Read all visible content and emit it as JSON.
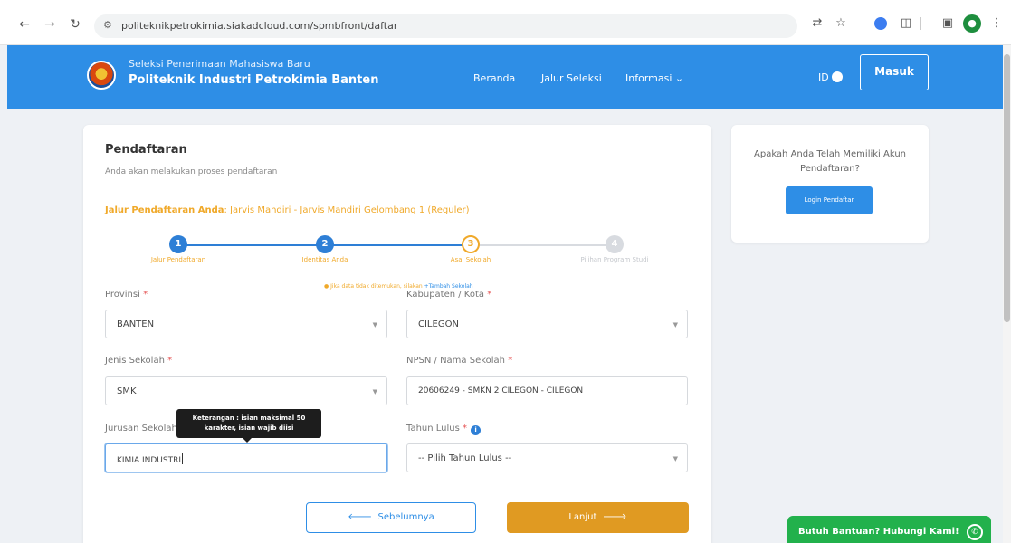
{
  "browser": {
    "url": "politeknikpetrokimia.siakadcloud.com/spmbfront/daftar"
  },
  "header": {
    "subtitle": "Seleksi Penerimaan Mahasiswa Baru",
    "title": "Politeknik Industri Petrokimia Banten",
    "menu": [
      "Beranda",
      "Jalur Seleksi",
      "Informasi ⌄"
    ],
    "lang": "ID",
    "login_label": "Masuk"
  },
  "form": {
    "title": "Pendaftaran",
    "subtitle": "Anda akan melakukan proses pendaftaran",
    "jalur_label": "Jalur Pendaftaran Anda",
    "jalur_value": ": Jarvis Mandiri - Jarvis Mandiri Gelombang 1 (Reguler)",
    "steps": [
      {
        "num": "1",
        "label": "Jalur Pendaftaran",
        "state": "done"
      },
      {
        "num": "2",
        "label": "Identitas Anda",
        "state": "done"
      },
      {
        "num": "3",
        "label": "Asal Sekolah",
        "state": "active"
      },
      {
        "num": "4",
        "label": "Pilihan Program Studi",
        "state": "pending"
      }
    ],
    "provinsi_label": "Provinsi",
    "provinsi_value": "BANTEN",
    "kabupaten_label": "Kabupaten / Kota",
    "kabupaten_value": "CILEGON",
    "jenis_label": "Jenis Sekolah",
    "jenis_value": "SMK",
    "npsn_label": "NPSN / Nama Sekolah",
    "npsn_value": "20606249 - SMKN 2 CILEGON - CILEGON",
    "hint_text": "Jika data tidak ditemukan, silakan",
    "hint_link": "+Tambah Sekolah",
    "jurusan_label": "Jurusan Sekolah",
    "jurusan_value": "KIMIA INDUSTRI",
    "tahun_label": "Tahun Lulus",
    "tahun_placeholder": "-- Pilih Tahun Lulus --",
    "tooltip_line1": "Keterangan : isian maksimal 50",
    "tooltip_line2": "karakter, isian wajib diisi",
    "required_mark": "*",
    "prev_label": "Sebelumnya",
    "next_label": "Lanjut"
  },
  "side": {
    "question": "Apakah Anda Telah Memiliki Akun Pendaftaran?",
    "button_label": "Login Pendaftar"
  },
  "whatsapp": {
    "label": "Butuh Bantuan? Hubungi Kami!"
  },
  "colors": {
    "primary": "#2e8ee6",
    "accent": "#e09a22",
    "whatsapp": "#22b14c"
  }
}
